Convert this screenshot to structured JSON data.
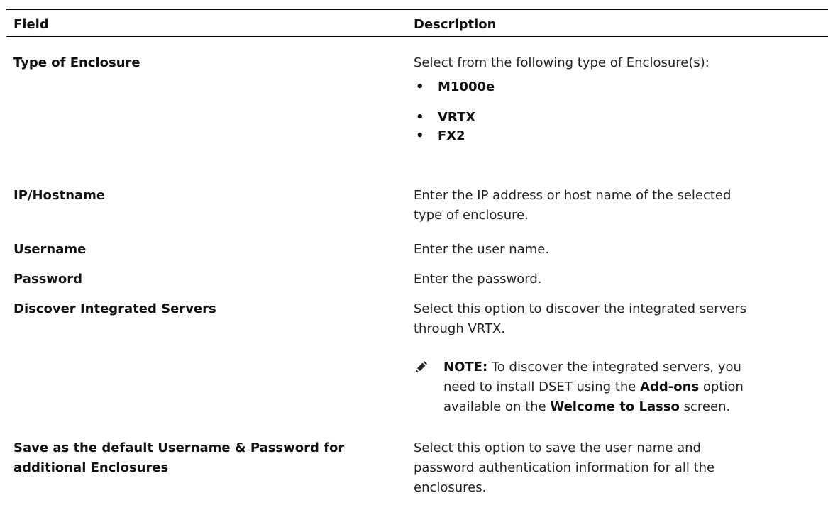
{
  "table": {
    "headers": {
      "field": "Field",
      "description": "Description"
    },
    "rows": [
      {
        "label": "Type of Enclosure",
        "description": "Select from the following type of Enclosure(s):",
        "options": [
          "M1000e",
          "VRTX",
          "FX2"
        ]
      },
      {
        "label": "IP/Hostname",
        "description_line1": "Enter the IP address or host name of the selected",
        "description_line2": "type of enclosure."
      },
      {
        "label": "Username",
        "description": "Enter the user name."
      },
      {
        "label": "Password",
        "description": "Enter the password."
      },
      {
        "label": "Discover Integrated Servers",
        "description_line1": "Select this option to discover the integrated servers",
        "description_line2": "through VRTX.",
        "note": {
          "icon": "pencil-note-icon",
          "prefix": "NOTE:",
          "line1": "To discover the integrated servers, you",
          "line2_a": "need to install DSET using the",
          "line2_bold": "Add-ons",
          "line2_b": "option",
          "line3_a": "available on the",
          "line3_bold": "Welcome to Lasso",
          "line3_b": "screen."
        }
      },
      {
        "label_line1": "Save as the default Username & Password for",
        "label_line2": "additional Enclosures",
        "description_line1": "Select this option to save the user name and",
        "description_line2": "password authentication information for all the",
        "description_line3": "enclosures."
      }
    ]
  }
}
